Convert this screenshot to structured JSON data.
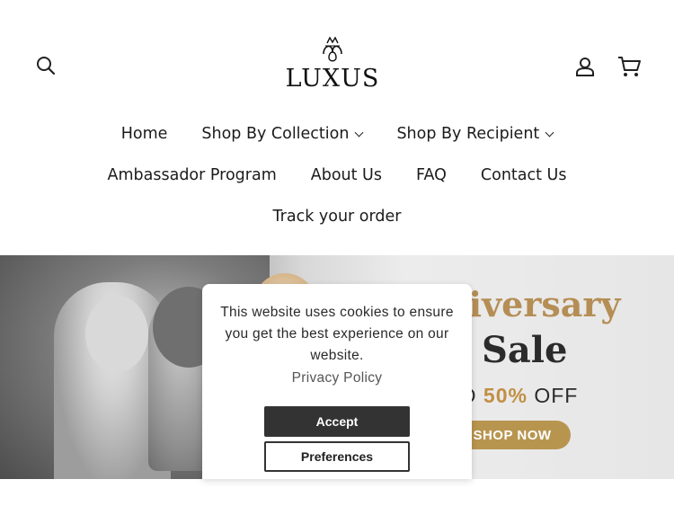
{
  "header": {
    "logo_text": "LUXUS",
    "icons": {
      "search": "search-icon",
      "login": "user-icon",
      "cart": "cart-icon"
    }
  },
  "nav": {
    "row1": [
      {
        "label": "Home",
        "dropdown": false
      },
      {
        "label": "Shop By Collection",
        "dropdown": true
      },
      {
        "label": "Shop By Recipient",
        "dropdown": true
      }
    ],
    "row2": [
      {
        "label": "Ambassador Program"
      },
      {
        "label": "About Us"
      },
      {
        "label": "FAQ"
      },
      {
        "label": "Contact Us"
      }
    ],
    "row3": [
      {
        "label": "Track your order"
      }
    ]
  },
  "hero": {
    "headline_partial": "niversary",
    "subhead": "Sale",
    "offer_prefix": "TO",
    "offer_pct": "50%",
    "offer_suffix": "OFF",
    "cta": "SHOP NOW",
    "colors": {
      "gold": "#b8954f",
      "dark": "#2b2b2b"
    }
  },
  "cookie_banner": {
    "message": "This website uses cookies to ensure you get the best experience on our website.",
    "policy_link": "Privacy Policy",
    "accept_label": "Accept",
    "preferences_label": "Preferences"
  }
}
